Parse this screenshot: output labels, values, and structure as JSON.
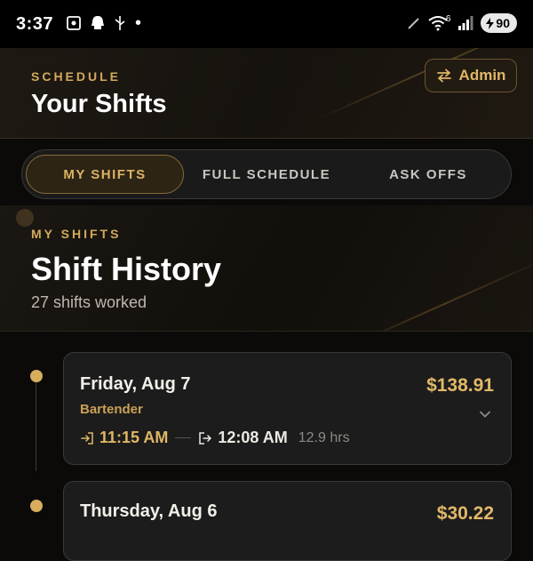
{
  "status_bar": {
    "time": "3:37",
    "battery": "90",
    "network_badge": "6"
  },
  "header": {
    "eyebrow": "SCHEDULE",
    "title": "Your Shifts",
    "admin_label": "Admin"
  },
  "tabs": [
    {
      "label": "MY SHIFTS",
      "active": true
    },
    {
      "label": "FULL SCHEDULE",
      "active": false
    },
    {
      "label": "ASK OFFS",
      "active": false
    }
  ],
  "history": {
    "eyebrow": "MY SHIFTS",
    "title": "Shift History",
    "subtitle": "27 shifts worked"
  },
  "shifts": [
    {
      "date": "Friday, Aug 7",
      "role": "Bartender",
      "amount": "$138.91",
      "clock_in": "11:15 AM",
      "clock_out": "12:08 AM",
      "hours": "12.9 hrs"
    },
    {
      "date": "Thursday, Aug 6",
      "role": "",
      "amount": "$30.22"
    }
  ],
  "colors": {
    "accent": "#d8ad5c",
    "background": "#0b0a09",
    "card": "#1c1c1c"
  }
}
